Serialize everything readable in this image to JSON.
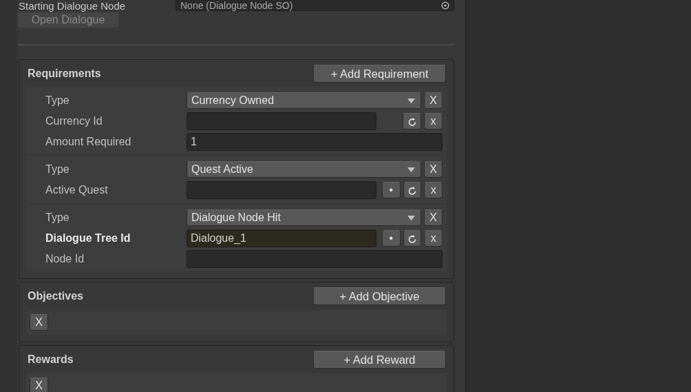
{
  "header_field": {
    "label": "Starting Dialogue Node",
    "value": "None (Dialogue Node SO)"
  },
  "open_button": {
    "label": "Open Dialogue",
    "disabled": true
  },
  "sections": [
    {
      "title": "Requirements",
      "add_button": "+ Add Requirement",
      "items": [
        {
          "kind": "requirement",
          "fields": [
            {
              "kind": "dropdown",
              "label": "Type",
              "value": "Currency Owned",
              "remove": "X",
              "modified": false
            },
            {
              "kind": "id",
              "label": "Currency Id",
              "reset": "x",
              "modified": false
            },
            {
              "kind": "text",
              "label": "Amount Required",
              "value": "1",
              "modified": false
            }
          ]
        },
        {
          "kind": "requirement",
          "fields": [
            {
              "kind": "dropdown",
              "label": "Type",
              "value": "Quest Active",
              "remove": "X",
              "modified": false
            },
            {
              "kind": "id",
              "label": "Active Quest",
              "pick": "•",
              "reset": "x",
              "modified": false
            }
          ]
        },
        {
          "kind": "requirement",
          "fields": [
            {
              "kind": "dropdown",
              "label": "Type",
              "value": "Dialogue Node Hit",
              "remove": "X",
              "modified": false
            },
            {
              "kind": "id",
              "label": "Dialogue Tree Id",
              "value": "Dialogue_1",
              "pick": "•",
              "reset": "x",
              "modified": true
            },
            {
              "kind": "text",
              "label": "Node Id",
              "modified": false
            }
          ]
        }
      ]
    },
    {
      "title": "Objectives",
      "add_button": "+ Add Objective",
      "items": [
        {
          "kind": "empty",
          "remove": "X"
        }
      ]
    },
    {
      "title": "Rewards",
      "add_button": "+ Add Reward",
      "items": [
        {
          "kind": "empty",
          "remove": "X"
        }
      ]
    }
  ]
}
